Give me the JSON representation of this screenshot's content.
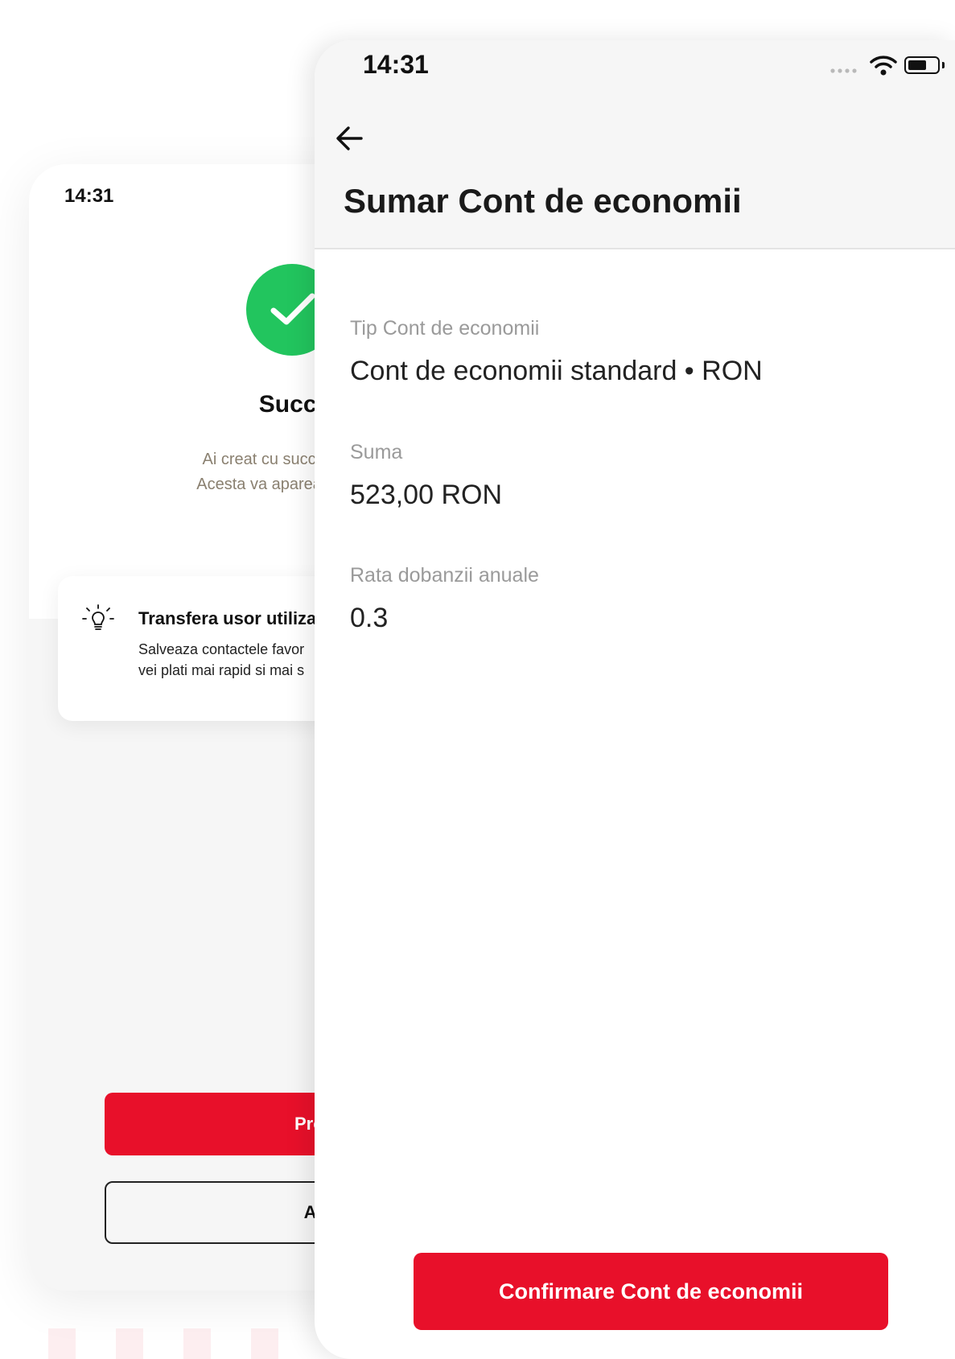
{
  "background_screen": {
    "status_time": "14:31",
    "success_title": "Succe",
    "success_text": [
      "Ai creat cu succes un nou",
      "Acesta va aparea in curand"
    ],
    "tip": {
      "icon": "lightbulb-icon",
      "title": "Transfera usor utiliza",
      "body": "Salveaza contactele favor\nvei plati mai rapid si mai s"
    },
    "primary_button": "Produse",
    "secondary_button": "Acasa",
    "colors": {
      "success": "#22c55e",
      "accent": "#e8102a"
    }
  },
  "summary_screen": {
    "status_time": "14:31",
    "back_icon": "arrow-left-icon",
    "title": "Sumar Cont de economii",
    "fields": [
      {
        "label": "Tip Cont de economii",
        "value": "Cont de economii standard • RON"
      },
      {
        "label": "Suma",
        "value": "523,00 RON"
      },
      {
        "label": "Rata dobanzii anuale",
        "value": "0.3"
      }
    ],
    "confirm_button": "Confirmare Cont de economii",
    "colors": {
      "accent": "#e8102a",
      "header_bg": "#f6f6f6"
    }
  }
}
